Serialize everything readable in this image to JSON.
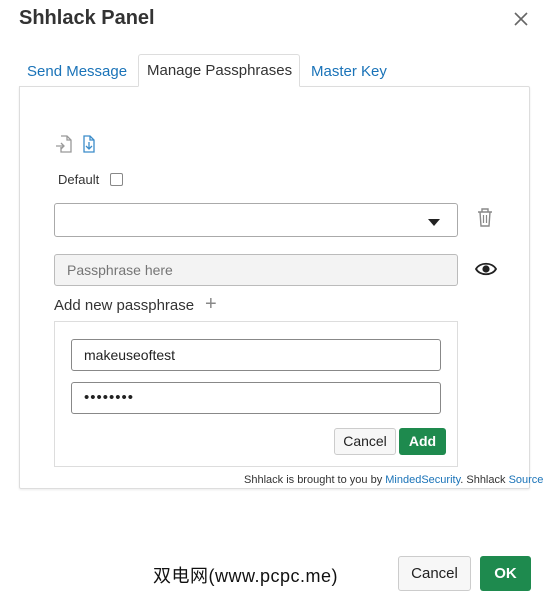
{
  "dialog": {
    "title": "Shhlack Panel"
  },
  "tabs": [
    {
      "label": "Send Message",
      "active": false
    },
    {
      "label": "Manage Passphrases",
      "active": true
    },
    {
      "label": "Master Key",
      "active": false
    }
  ],
  "manage": {
    "icons": [
      "import-icon",
      "export-icon",
      "trash-icon",
      "eye-icon"
    ],
    "default_label": "Default",
    "default_checked": false,
    "select_value": "",
    "passphrase_placeholder": "Passphrase here",
    "add_new_label": "Add new passphrase",
    "add_plus": "+",
    "new_name_value": "makeuseoftest",
    "new_secret_masked": "••••••••",
    "cancel_label": "Cancel",
    "add_label": "Add"
  },
  "footer": {
    "prefix": "Shhlack is brought to you by ",
    "link1": "MindedSecurity",
    "middle": ". Shhlack ",
    "link2": "Source"
  },
  "watermark": "双电网(www.pcpc.me)",
  "actions": {
    "cancel_label": "Cancel",
    "ok_label": "OK"
  },
  "colors": {
    "accent_link": "#1a73b8",
    "primary_button": "#1e8a4e"
  }
}
